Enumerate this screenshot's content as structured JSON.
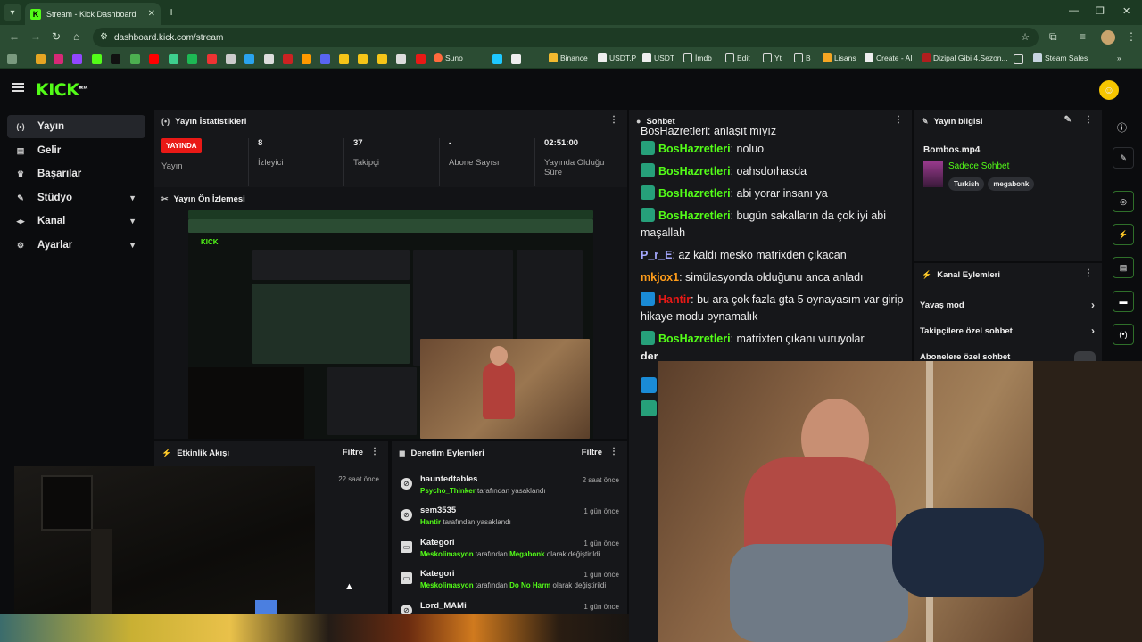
{
  "browser": {
    "tab_title": "Stream - Kick Dashboard",
    "url": "dashboard.kick.com/stream",
    "bookmarks": [
      "Suno",
      "Binance",
      "USDT.P",
      "USDT",
      "İmdb",
      "Edit",
      "Yt",
      "B",
      "Lisans",
      "Create - AI",
      "Dizipal Gibi 4.Sezon...",
      "Steam Sales"
    ]
  },
  "sidebar": {
    "items": [
      {
        "label": "Yayın",
        "icon": "broadcast-icon"
      },
      {
        "label": "Gelir",
        "icon": "revenue-icon"
      },
      {
        "label": "Başarılar",
        "icon": "trophy-icon"
      },
      {
        "label": "Stüdyo",
        "icon": "studio-icon"
      },
      {
        "label": "Kanal",
        "icon": "channel-icon"
      },
      {
        "label": "Ayarlar",
        "icon": "settings-icon"
      }
    ]
  },
  "stats": {
    "title": "Yayın İstatistikleri",
    "live_badge": "YAYINDA",
    "live_label": "Yayın",
    "viewers_value": "8",
    "viewers_label": "İzleyici",
    "followers_value": "37",
    "followers_label": "Takipçi",
    "subs_value": "-",
    "subs_label": "Abone Sayısı",
    "duration_value": "02:51:00",
    "duration_label_1": "Yayında Olduğu",
    "duration_label_2": "Süre"
  },
  "preview": {
    "title": "Yayın Ön İzlemesi"
  },
  "activity": {
    "title": "Etkinlik Akışı",
    "filter": "Filtre",
    "time": "22 saat önce"
  },
  "moderation": {
    "title": "Denetim Eylemleri",
    "filter": "Filtre",
    "rows": [
      {
        "title": "hauntedtables",
        "actor": "Psycho_Thinker",
        "text": " tarafından yasaklandı",
        "extra": "",
        "tail": "",
        "when": "2 saat önce"
      },
      {
        "title": "sem3535",
        "actor": "Hantir",
        "text": " tarafından yasaklandı",
        "extra": "",
        "tail": "",
        "when": "1 gün önce"
      },
      {
        "title": "Kategori",
        "actor": "Meskolimasyon",
        "text": " tarafından ",
        "extra": "Megabonk",
        "tail": " olarak değiştirildi",
        "when": "1 gün önce"
      },
      {
        "title": "Kategori",
        "actor": "Meskolimasyon",
        "text": " tarafından ",
        "extra": "Do No Harm",
        "tail": " olarak değiştirildi",
        "when": "1 gün önce"
      },
      {
        "title": "Lord_MAMi",
        "actor": "",
        "text": "",
        "extra": "",
        "tail": "",
        "when": "1 gün önce"
      }
    ]
  },
  "chat": {
    "title": "Sohbet",
    "partial_top": "BosHazretleri: anlaşıt mıyız",
    "messages": [
      {
        "user": "BosHazretleri",
        "color": "#53fc18",
        "badge": "green",
        "text": "noluo"
      },
      {
        "user": "BosHazretleri",
        "color": "#53fc18",
        "badge": "green",
        "text": "oahsdoıhasda"
      },
      {
        "user": "BosHazretleri",
        "color": "#53fc18",
        "badge": "green",
        "text": "abi yorar insanı ya"
      },
      {
        "user": "BosHazretleri",
        "color": "#53fc18",
        "badge": "green",
        "text": "bugün sakalların da çok iyi abi maşallah"
      },
      {
        "user": "P_r_E",
        "color": "#a5a8ff",
        "badge": "",
        "text": "az kaldı mesko matrixden çıkacan"
      },
      {
        "user": "mkjox1",
        "color": "#ff9d1a",
        "badge": "",
        "text": "simülasyonda olduğunu anca anladı"
      },
      {
        "user": "Hantir",
        "color": "#e91916",
        "badge": "blue",
        "text": "bu ara çok fazla gta 5 oynayasım var girip hikaye modu oynamalık"
      },
      {
        "user": "BosHazretleri",
        "color": "#53fc18",
        "badge": "green",
        "text": "matrixten çıkanı vuruyolar"
      },
      {
        "user": "der",
        "color": "#eeeeee",
        "badge": "",
        "text": ""
      }
    ]
  },
  "stream_info": {
    "title": "Yayın bilgisi",
    "stream_title": "Bombos.mp4",
    "category": "Sadece Sohbet",
    "tags": [
      "Turkish",
      "megabonk"
    ]
  },
  "channel_actions": {
    "title": "Kanal Eylemleri",
    "items": [
      "Yavaş mod",
      "Takipçilere özel sohbet",
      "Abonelere özel sohbet"
    ]
  },
  "colors": {
    "brand": "#53fc18",
    "live": "#e91916",
    "panel": "#16171a"
  }
}
